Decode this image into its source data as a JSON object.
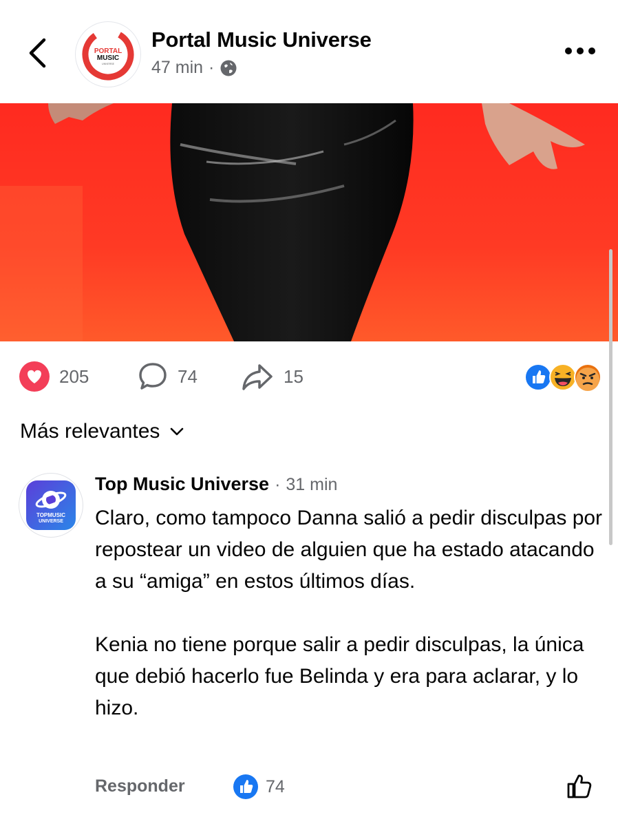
{
  "header": {
    "page_name": "Portal Music Universe",
    "time": "47 min",
    "separator": "·",
    "privacy_icon": "globe-icon",
    "back_icon": "chevron-left-icon",
    "more_icon": "more-horizontal-icon",
    "avatar_text": "PORTAL MUSIC",
    "avatar_subtext": "UNIVERSE"
  },
  "post_stats": {
    "reactions": "205",
    "comments": "74",
    "shares": "15",
    "reaction_icons": [
      "like-reaction-icon",
      "haha-reaction-icon",
      "angry-reaction-icon"
    ]
  },
  "sort": {
    "label": "Más relevantes",
    "icon": "chevron-down-icon"
  },
  "comment": {
    "author": "Top Music Universe",
    "time": "31 min",
    "separator": "·",
    "avatar_text": "TOPMUSIC",
    "avatar_subtext": "UNIVERSE",
    "paragraphs": [
      "Claro, como tampoco Danna salió a pedir disculpas por repostear un video de alguien que ha estado atacando a su “amiga” en estos últimos días.",
      "Kenia no tiene porque salir a pedir disculpas, la única que debió hacerlo fue Belinda y era para aclarar, y lo hizo."
    ],
    "reply_label": "Responder",
    "like_count": "74"
  },
  "colors": {
    "heart": "#f33e58",
    "like_blue": "#1877f2",
    "secondary_text": "#65676b",
    "photo_red": "#ff2f25"
  }
}
